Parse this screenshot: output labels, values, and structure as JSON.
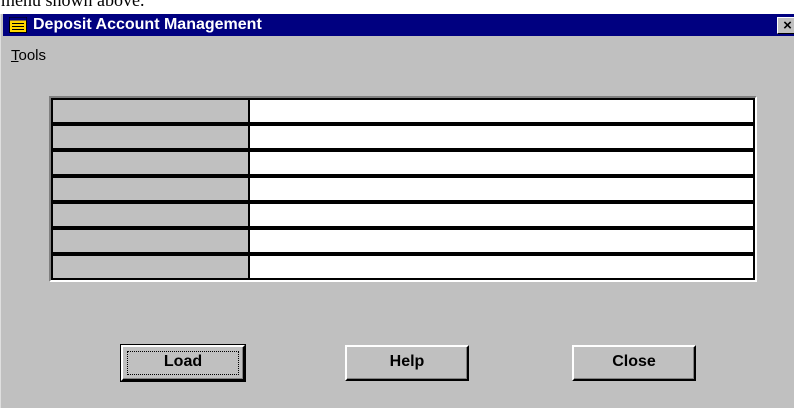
{
  "partial_text": "menu shown above.",
  "window": {
    "title": "Deposit Account Management",
    "close_glyph": "×",
    "icon": "yellow-window-icon"
  },
  "menu": {
    "tools_first": "T",
    "tools_rest": "ools"
  },
  "grid": {
    "rows": [
      {
        "label": "",
        "value": ""
      },
      {
        "label": "",
        "value": ""
      },
      {
        "label": "",
        "value": ""
      },
      {
        "label": "",
        "value": ""
      },
      {
        "label": "",
        "value": ""
      },
      {
        "label": "",
        "value": ""
      },
      {
        "label": "",
        "value": ""
      }
    ]
  },
  "buttons": {
    "load": "Load",
    "help": "Help",
    "close": "Close"
  },
  "colors": {
    "titlebar": "#000080",
    "face": "#c0c0c0",
    "icon": "#ffd800"
  }
}
